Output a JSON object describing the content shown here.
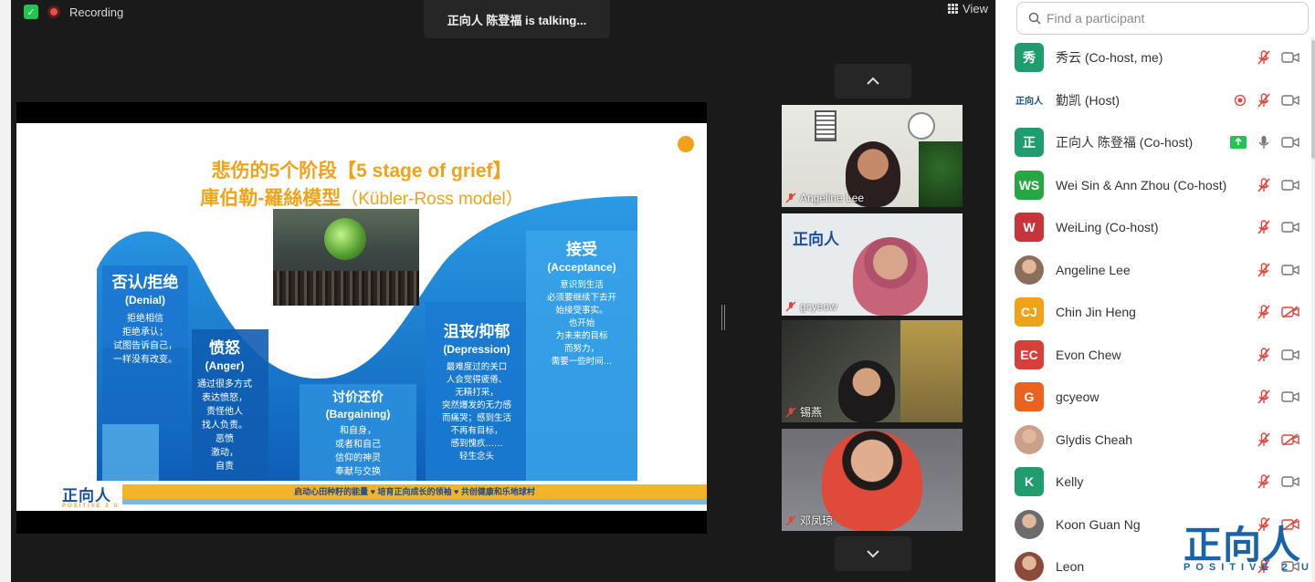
{
  "topbar": {
    "recording_label": "Recording",
    "talking_text": "正向人  陈登福 is talking...",
    "view_label": "View"
  },
  "slide": {
    "title_line1": "悲伤的5个阶段【5 stage of grief】",
    "title_line2_cn": "庫伯勒-羅絲模型",
    "title_line2_en": "（Kübler-Ross model）",
    "stages": [
      {
        "cn": "否认/拒绝",
        "en": "(Denial)",
        "desc": [
          "拒绝相信",
          "拒绝承认；",
          "试图告诉自己，",
          "一样没有改变。"
        ]
      },
      {
        "cn": "愤怒",
        "en": "(Anger)",
        "desc": [
          "通过很多方式",
          "表达愤怒，",
          "责怪他人",
          "找人负责。",
          "恶愤",
          "激动，",
          "自责"
        ]
      },
      {
        "cn": "讨价还价",
        "en": "(Bargaining)",
        "desc": [
          "和自身，",
          "或者和自己",
          "信仰的神灵",
          "奉献与交换"
        ]
      },
      {
        "cn": "沮丧/抑郁",
        "en": "(Depression)",
        "desc": [
          "最难度过的关口",
          "人会觉得疲倦、",
          "无精打采，",
          "突然爆发的无力感",
          "而痛哭；感到生活",
          "不再有目标，",
          "感到愧疚……",
          "轻生念头"
        ]
      },
      {
        "cn": "接受",
        "en": "(Acceptance)",
        "desc": [
          "意识到生活",
          "必须要继续下去开",
          "始接受事实。",
          "也开始",
          "为未来的目标",
          "而努力，",
          "需要一些时间…"
        ]
      }
    ],
    "footer_logo": "正向人",
    "footer_logo_sub": "POSITIVE 2 U",
    "footer_slogan": "启动心田种籽的能量 ♥ 培育正向成长的领袖 ♥ 共创健康和乐地球村"
  },
  "thumbnails": [
    {
      "name": "Angeline Lee"
    },
    {
      "name": "gcyeow",
      "logo": "正向人"
    },
    {
      "name": "锡燕"
    },
    {
      "name": "邓凤琼"
    }
  ],
  "panel": {
    "search_placeholder": "Find a participant",
    "participants": [
      {
        "name": "秀云 (Co-host, me)",
        "avatar_text": "秀",
        "avatar_color": "#1f9d6e",
        "mic": "muted",
        "video": "on"
      },
      {
        "name": "勤凯 (Host)",
        "avatar_text": "正向人",
        "avatar_color": "#ffffff",
        "mic": "muted",
        "video": "on",
        "record": true
      },
      {
        "name": "正向人  陈登福 (Co-host)",
        "avatar_text": "正",
        "avatar_color": "#1f9d6e",
        "mic": "active",
        "video": "on",
        "share": true
      },
      {
        "name": "Wei Sin & Ann Zhou (Co-host)",
        "avatar_text": "WS",
        "avatar_color": "#27a744",
        "mic": "muted",
        "video": "on"
      },
      {
        "name": "WeiLing (Co-host)",
        "avatar_text": "W",
        "avatar_color": "#c7343a",
        "mic": "muted",
        "video": "on"
      },
      {
        "name": "Angeline Lee",
        "avatar_text": "",
        "avatar_color": "#8a6f5c",
        "mic": "muted",
        "video": "on"
      },
      {
        "name": "Chin Jin Heng",
        "avatar_text": "CJ",
        "avatar_color": "#f0a318",
        "mic": "muted",
        "video": "off"
      },
      {
        "name": "Evon Chew",
        "avatar_text": "EC",
        "avatar_color": "#d6403a",
        "mic": "muted",
        "video": "on"
      },
      {
        "name": "gcyeow",
        "avatar_text": "G",
        "avatar_color": "#e8631f",
        "mic": "muted",
        "video": "on"
      },
      {
        "name": "Glydis Cheah",
        "avatar_text": "",
        "avatar_color": "#c9a08a",
        "mic": "muted",
        "video": "off"
      },
      {
        "name": "Kelly",
        "avatar_text": "K",
        "avatar_color": "#1f9d6e",
        "mic": "muted",
        "video": "on"
      },
      {
        "name": "Koon Guan Ng",
        "avatar_text": "",
        "avatar_color": "#6b6b6b",
        "mic": "muted",
        "video": "off"
      },
      {
        "name": "Leon",
        "avatar_text": "",
        "avatar_color": "#8b4a3a",
        "mic": "muted",
        "video": "on"
      }
    ]
  },
  "watermark": {
    "text": "正向人",
    "sub": "POSITIVE 2 U"
  },
  "colors": {
    "accent_orange": "#f0a318",
    "slide_blue": "#1f7fd0",
    "muted_red": "#e0453d",
    "zoom_green": "#23c552"
  }
}
